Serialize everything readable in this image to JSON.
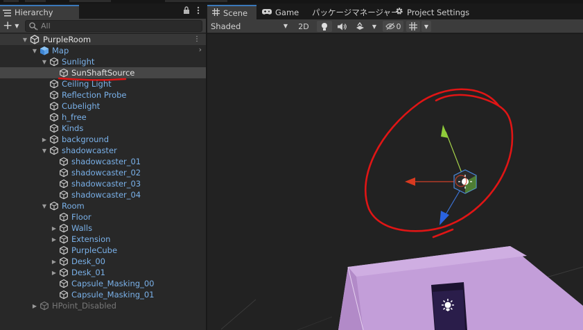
{
  "hierarchy": {
    "tab_label": "Hierarchy",
    "search_placeholder": "All",
    "scene_name": "PurpleRoom",
    "rows": [
      {
        "label": "Map",
        "indent": 1,
        "arrow": "down",
        "icon": "prefab",
        "color": "blue"
      },
      {
        "label": "Sunlight",
        "indent": 2,
        "arrow": "down",
        "icon": "cube",
        "color": "blue"
      },
      {
        "label": "SunShaftSource",
        "indent": 3,
        "arrow": "",
        "icon": "cube",
        "color": "white",
        "selected": true
      },
      {
        "label": "Ceiling Light",
        "indent": 2,
        "arrow": "",
        "icon": "cube",
        "color": "blue"
      },
      {
        "label": "Reflection Probe",
        "indent": 2,
        "arrow": "",
        "icon": "cube",
        "color": "blue"
      },
      {
        "label": "Cubelight",
        "indent": 2,
        "arrow": "",
        "icon": "cube",
        "color": "blue"
      },
      {
        "label": "h_free",
        "indent": 2,
        "arrow": "",
        "icon": "cube",
        "color": "blue"
      },
      {
        "label": "Kinds",
        "indent": 2,
        "arrow": "",
        "icon": "cube",
        "color": "blue"
      },
      {
        "label": "background",
        "indent": 2,
        "arrow": "right",
        "icon": "cube",
        "color": "blue"
      },
      {
        "label": "shadowcaster",
        "indent": 2,
        "arrow": "down",
        "icon": "cube",
        "color": "blue"
      },
      {
        "label": "shadowcaster_01",
        "indent": 3,
        "arrow": "",
        "icon": "cube",
        "color": "blue"
      },
      {
        "label": "shadowcaster_02",
        "indent": 3,
        "arrow": "",
        "icon": "cube",
        "color": "blue"
      },
      {
        "label": "shadowcaster_03",
        "indent": 3,
        "arrow": "",
        "icon": "cube",
        "color": "blue"
      },
      {
        "label": "shadowcaster_04",
        "indent": 3,
        "arrow": "",
        "icon": "cube",
        "color": "blue"
      },
      {
        "label": "Room",
        "indent": 2,
        "arrow": "down",
        "icon": "cube",
        "color": "blue"
      },
      {
        "label": "Floor",
        "indent": 3,
        "arrow": "",
        "icon": "cube",
        "color": "blue"
      },
      {
        "label": "Walls",
        "indent": 3,
        "arrow": "right",
        "icon": "cube",
        "color": "blue"
      },
      {
        "label": "Extension",
        "indent": 3,
        "arrow": "right",
        "icon": "cube",
        "color": "blue"
      },
      {
        "label": "PurpleCube",
        "indent": 3,
        "arrow": "",
        "icon": "cube",
        "color": "blue"
      },
      {
        "label": "Desk_00",
        "indent": 3,
        "arrow": "right",
        "icon": "cube",
        "color": "blue"
      },
      {
        "label": "Desk_01",
        "indent": 3,
        "arrow": "right",
        "icon": "cube",
        "color": "blue"
      },
      {
        "label": "Capsule_Masking_00",
        "indent": 3,
        "arrow": "",
        "icon": "cube",
        "color": "blue"
      },
      {
        "label": "Capsule_Masking_01",
        "indent": 3,
        "arrow": "",
        "icon": "cube",
        "color": "blue"
      },
      {
        "label": "HPoint_Disabled",
        "indent": 1,
        "arrow": "right",
        "icon": "cube",
        "color": "gray"
      }
    ]
  },
  "scene_tabs": [
    {
      "label": "Scene",
      "icon": "grid-icon",
      "active": true
    },
    {
      "label": "Game",
      "icon": "gamepad-icon",
      "active": false
    },
    {
      "label": "パッケージマネージャー",
      "icon": "",
      "active": false
    },
    {
      "label": "Project Settings",
      "icon": "gear-icon",
      "active": false
    }
  ],
  "scene_toolbar": {
    "draw_mode": "Shaded",
    "mode_2d": "2D",
    "hidden_count": "0"
  },
  "colors": {
    "accent": "#3a79bb",
    "prefab_blue": "#7ab1e9",
    "annotation_red": "#e01515",
    "cube_purple": "#c6a0dc"
  }
}
